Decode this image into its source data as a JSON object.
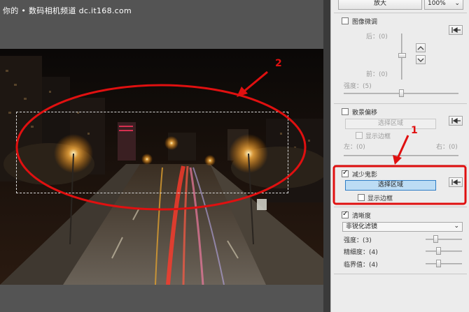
{
  "watermark": "你的 • 数码相机频道 dc.it168.com",
  "annotations": {
    "label_1": "1",
    "label_2": "2"
  },
  "toolbar": {
    "zoom_button": "放大",
    "zoom_level": "100%"
  },
  "fine_tune": {
    "title": "图像微调",
    "after_label": "后：(0)",
    "before_label": "前：(0)",
    "strength_label": "强度：(5)"
  },
  "bg_offset": {
    "title": "散景偏移",
    "select_button": "选择区域",
    "show_border": "显示边框",
    "left_label": "左：(0)",
    "right_label": "右：(0)"
  },
  "reduce_ghost": {
    "title": "减少鬼影",
    "select_button": "选择区域",
    "show_border": "显示边框"
  },
  "sharpness": {
    "title": "清晰度",
    "mode": "非锐化滤镜",
    "strength_label": "强度：(3)",
    "fineness_label": "精细度：(4)",
    "threshold_label": "临界值：(4)"
  },
  "colors": {
    "highlight_red": "#e01010",
    "select_blue": "#bcdcf4"
  }
}
